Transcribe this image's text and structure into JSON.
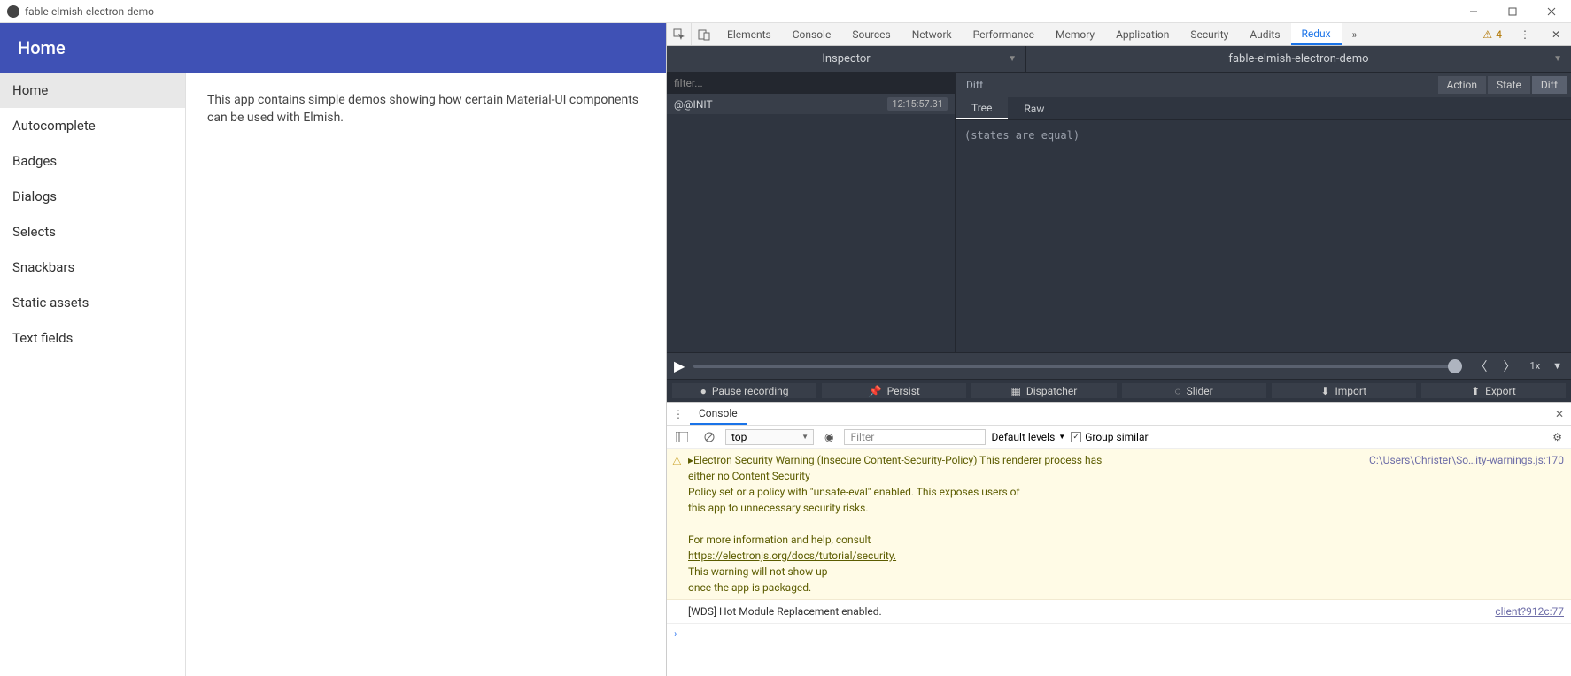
{
  "window": {
    "title": "fable-elmish-electron-demo"
  },
  "app": {
    "header_title": "Home",
    "nav": [
      {
        "label": "Home",
        "selected": true
      },
      {
        "label": "Autocomplete"
      },
      {
        "label": "Badges"
      },
      {
        "label": "Dialogs"
      },
      {
        "label": "Selects"
      },
      {
        "label": "Snackbars"
      },
      {
        "label": "Static assets"
      },
      {
        "label": "Text fields"
      }
    ],
    "body_text": "This app contains simple demos showing how certain Material-UI components can be used with Elmish."
  },
  "devtools": {
    "tabs": [
      "Elements",
      "Console",
      "Sources",
      "Network",
      "Performance",
      "Memory",
      "Application",
      "Security",
      "Audits",
      "Redux"
    ],
    "active_tab": "Redux",
    "warnings": "4"
  },
  "redux": {
    "left_dropdown": "Inspector",
    "right_dropdown": "fable-elmish-electron-demo",
    "filter_placeholder": "filter...",
    "actions": [
      {
        "name": "@@INIT",
        "time": "12:15:57.31"
      }
    ],
    "detail": {
      "mode_label": "Diff",
      "modes": [
        "Action",
        "State",
        "Diff"
      ],
      "active_mode": "Diff",
      "subtabs": [
        "Tree",
        "Raw"
      ],
      "active_subtab": "Tree",
      "body": "(states are equal)"
    },
    "playback": {
      "speed": "1x"
    },
    "toolbar": [
      "Pause recording",
      "Persist",
      "Dispatcher",
      "Slider",
      "Import",
      "Export"
    ]
  },
  "console": {
    "tab_label": "Console",
    "context": "top",
    "filter_placeholder": "Filter",
    "levels_label": "Default levels",
    "group_label": "Group similar",
    "messages": [
      {
        "kind": "warn",
        "source": "C:\\Users\\Christer\\So…ity-warnings.js:170",
        "lines": [
          "▸Electron Security Warning (Insecure Content-Security-Policy) This renderer process has",
          "either no Content Security",
          "  Policy set or a policy with \"unsafe-eval\" enabled. This exposes users of",
          "  this app to unnecessary security risks.",
          "",
          "For more information and help, consult",
          "https://electronjs.org/docs/tutorial/security.",
          " This warning will not show up",
          "once the app is packaged."
        ]
      },
      {
        "kind": "plain",
        "source": "client?912c:77",
        "lines": [
          "[WDS] Hot Module Replacement enabled."
        ]
      }
    ]
  }
}
